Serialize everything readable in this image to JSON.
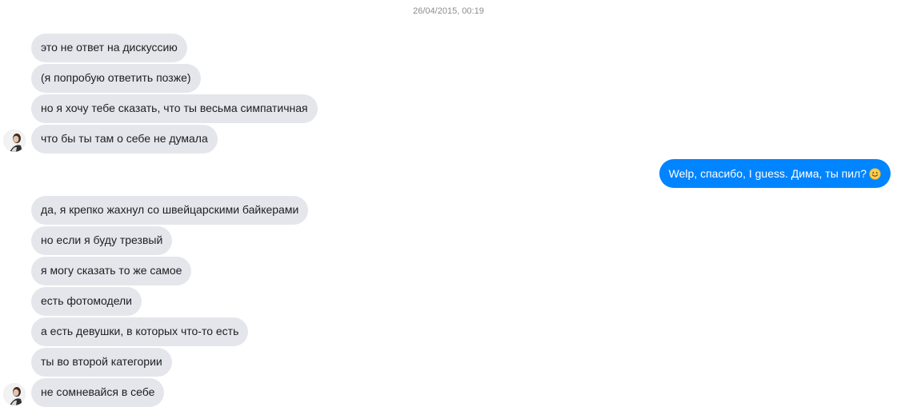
{
  "thread": {
    "timestamp": "26/04/2015, 00:19"
  },
  "group1": {
    "messages": [
      "это не ответ на дискуссию",
      "(я попробую ответить позже)",
      "но я хочу тебе сказать, что ты весьма симпатичная",
      "что бы ты там о себе не думала"
    ]
  },
  "outgoing": {
    "text": "Welp, спасибо, I guess. Дима, ты пил?",
    "emoji": "smiley-emoji-icon"
  },
  "group2": {
    "messages": [
      "да, я крепко жахнул со швейцарскими байкерами",
      "но если я буду трезвый",
      "я могу сказать то же самое",
      "есть фотомодели",
      "а есть девушки, в которых что-то есть",
      "ты во второй категории",
      "не сомневайся в себе"
    ]
  },
  "colors": {
    "incoming_bubble": "#e4e6eb",
    "outgoing_bubble": "#0084ff"
  }
}
